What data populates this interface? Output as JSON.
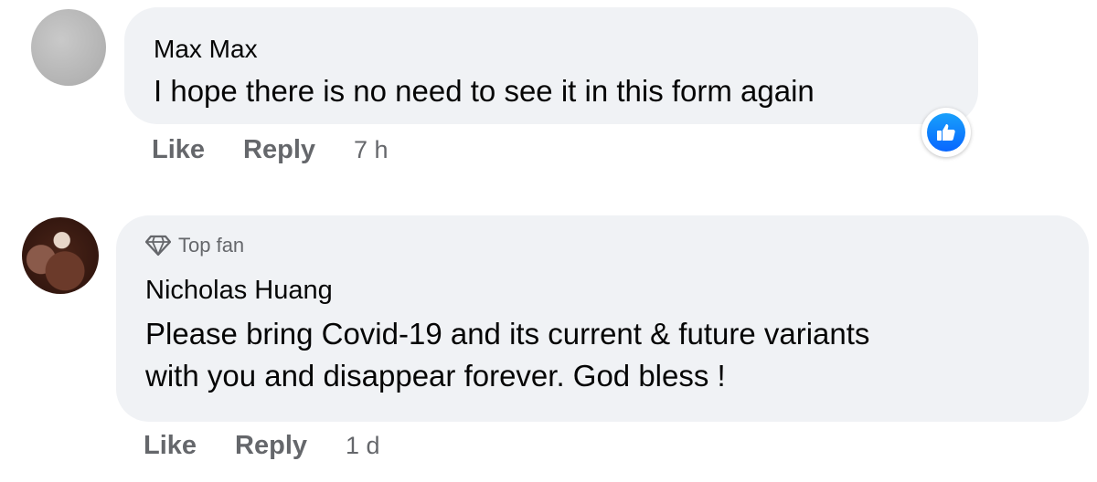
{
  "comments": [
    {
      "author": "Max Max",
      "text": "I hope there is no need to see it in this form again",
      "actions": {
        "like": "Like",
        "reply": "Reply"
      },
      "time": "7 h",
      "reaction_icon": "thumbs-up-icon",
      "avatar_icon": "grey-avatar"
    },
    {
      "badge": "Top fan",
      "badge_icon": "diamond-icon",
      "author": "Nicholas Huang",
      "text_lines": [
        "Please bring Covid-19 and its current & future variants",
        "with you and disappear forever. God bless !"
      ],
      "actions": {
        "like": "Like",
        "reply": "Reply"
      },
      "time": "1 d",
      "avatar_icon": "profile-photo-avatar"
    }
  ],
  "colors": {
    "bubble_bg": "#f0f2f5",
    "secondary_text": "#65676b",
    "primary_text": "#050505",
    "like_blue": "#0866ff"
  }
}
